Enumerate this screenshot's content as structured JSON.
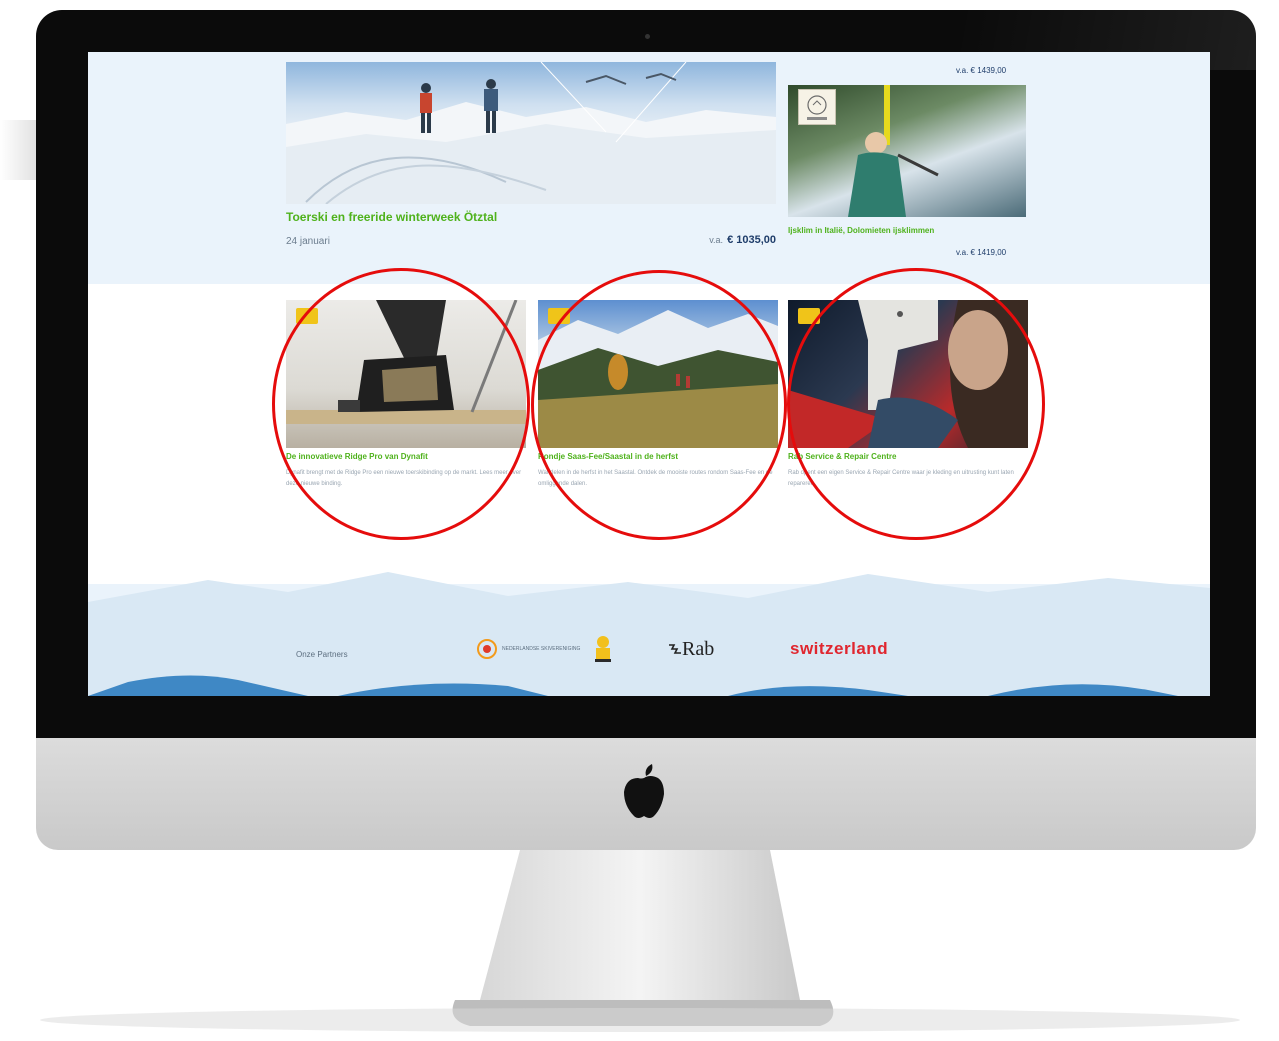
{
  "feature": {
    "title": "Toerski en freeride winterweek Ötztal",
    "date": "24 januari",
    "price_prefix": "v.a.",
    "price": "€ 1035,00"
  },
  "side_trip": {
    "price_top": "v.a. € 1439,00",
    "title": "Ijsklim in Italië, Dolomieten ijsklimmen",
    "price_bottom": "v.a. € 1419,00"
  },
  "cards": [
    {
      "title": "De innovatieve Ridge Pro van Dynafit",
      "desc": "Dynafit brengt met de Ridge Pro een nieuwe toerskibinding op de markt. Lees meer over deze nieuwe binding."
    },
    {
      "title": "Rondje Saas-Fee/Saastal in de herfst",
      "desc": "Wandelen in de herfst in het Saastal. Ontdek de mooiste routes rondom Saas-Fee en de omliggende dalen."
    },
    {
      "title": "Rab Service & Repair Centre",
      "desc": "Rab opent een eigen Service & Repair Centre waar je kleding en uitrusting kunt laten repareren."
    }
  ],
  "partners": {
    "label": "Onze Partners",
    "partner_1_text": "NEDERLANDSE SKIVERENIGING",
    "partner_3": "Rab",
    "partner_4": "switzerland"
  },
  "colors": {
    "accent_green": "#4fb21c",
    "price_navy": "#1f3d6a",
    "highlight_red": "#e50c0c",
    "screen_bg": "#eaf3fb",
    "mountain_dark": "#3f88c5",
    "switzerland_red": "#e0262f"
  },
  "icons": [
    "apple-logo-icon",
    "swiss-cross-icon"
  ]
}
